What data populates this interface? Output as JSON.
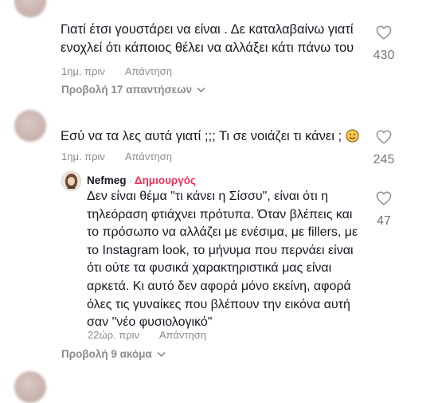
{
  "comments": [
    {
      "text_lines": [
        "Γιατί έτσι γουστάρει να είναι . Δε καταλαβαίνω γιατί",
        "ενοχλεί ότι κάποιος θέλει να αλλάξει κάτι πάνω του"
      ],
      "time": "1ημ. πριν",
      "reply_label": "Απάντηση",
      "likes": "430",
      "view_replies": "Προβολή 17 απαντήσεων"
    },
    {
      "text": "Εσύ να τα λες αυτά γιατί ;;; Τι σε νοιάζει τι κάνει ;",
      "time": "1ημ. πριν",
      "reply_label": "Απάντηση",
      "likes": "245",
      "reply": {
        "username": "Nefmeg",
        "separator": "·",
        "badge": "Δημιουργός",
        "text_lines": [
          "Δεν είναι θέμα \"τι κάνει η Σίσσυ\", είναι ότι η",
          "τηλεόραση φτιάχνει πρότυπα. Όταν βλέπεις και",
          "το πρόσωπο να αλλάζει με ενέσιμα, με fillers, με",
          "το Instagram look, το μήνυμα που περνάει είναι",
          "ότι ούτε τα φυσικά χαρακτηριστικά μας είναι",
          "αρκετά. Κι αυτό δεν αφορά μόνο εκείνη, αφορά",
          "όλες τις γυναίκες που βλέπουν την εικόνα αυτή",
          "σαν \"νέο φυσιολογικό\""
        ],
        "time": "22ώρ. πριν",
        "reply_label": "Απάντηση",
        "likes": "47"
      },
      "view_more": "Προβολή 9 ακόμα"
    }
  ],
  "icons": {
    "heart": "heart-icon",
    "chevron": "chevron-down-icon",
    "emoji": "smiling-face-emoji-icon"
  },
  "colors": {
    "creator_badge": "#fe2c55",
    "meta_text": "#8a8b91"
  }
}
